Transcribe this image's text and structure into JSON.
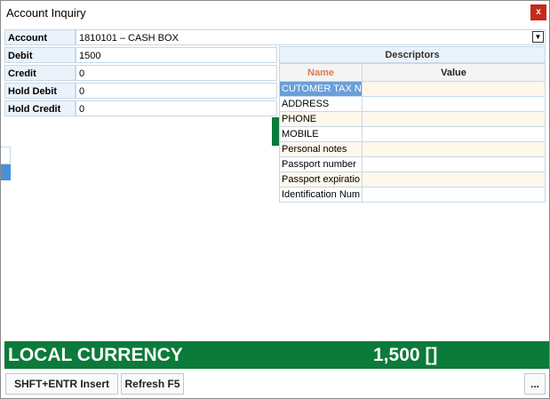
{
  "window": {
    "title": "Account Inquiry",
    "close_label": "x"
  },
  "account": {
    "label": "Account",
    "value": "1810101 – CASH BOX",
    "dropdown_glyph": "▼"
  },
  "fields": [
    {
      "label": "Debit",
      "value": "1500"
    },
    {
      "label": "Credit",
      "value": "0"
    },
    {
      "label": "Hold Debit",
      "value": "0"
    },
    {
      "label": "Hold Credit",
      "value": "0"
    }
  ],
  "descriptors": {
    "title": "Descriptors",
    "columns": {
      "name": "Name",
      "value": "Value"
    },
    "rows": [
      {
        "name": "CUTOMER TAX NU",
        "value": ""
      },
      {
        "name": "ADDRESS",
        "value": ""
      },
      {
        "name": "PHONE",
        "value": ""
      },
      {
        "name": "MOBILE",
        "value": ""
      },
      {
        "name": "Personal notes",
        "value": ""
      },
      {
        "name": "Passport number",
        "value": ""
      },
      {
        "name": "Passport expiratio",
        "value": ""
      },
      {
        "name": "Identification Num",
        "value": ""
      }
    ]
  },
  "currency_bar": {
    "label": "LOCAL CURRENCY",
    "amount": "1,500 []"
  },
  "buttons": {
    "insert": "SHFT+ENTR  Insert",
    "refresh": "Refresh F5",
    "more": "..."
  },
  "colors": {
    "accent_green": "#0b7a3a",
    "selection_blue": "#6a9fd8",
    "close_red": "#c42b1c"
  }
}
